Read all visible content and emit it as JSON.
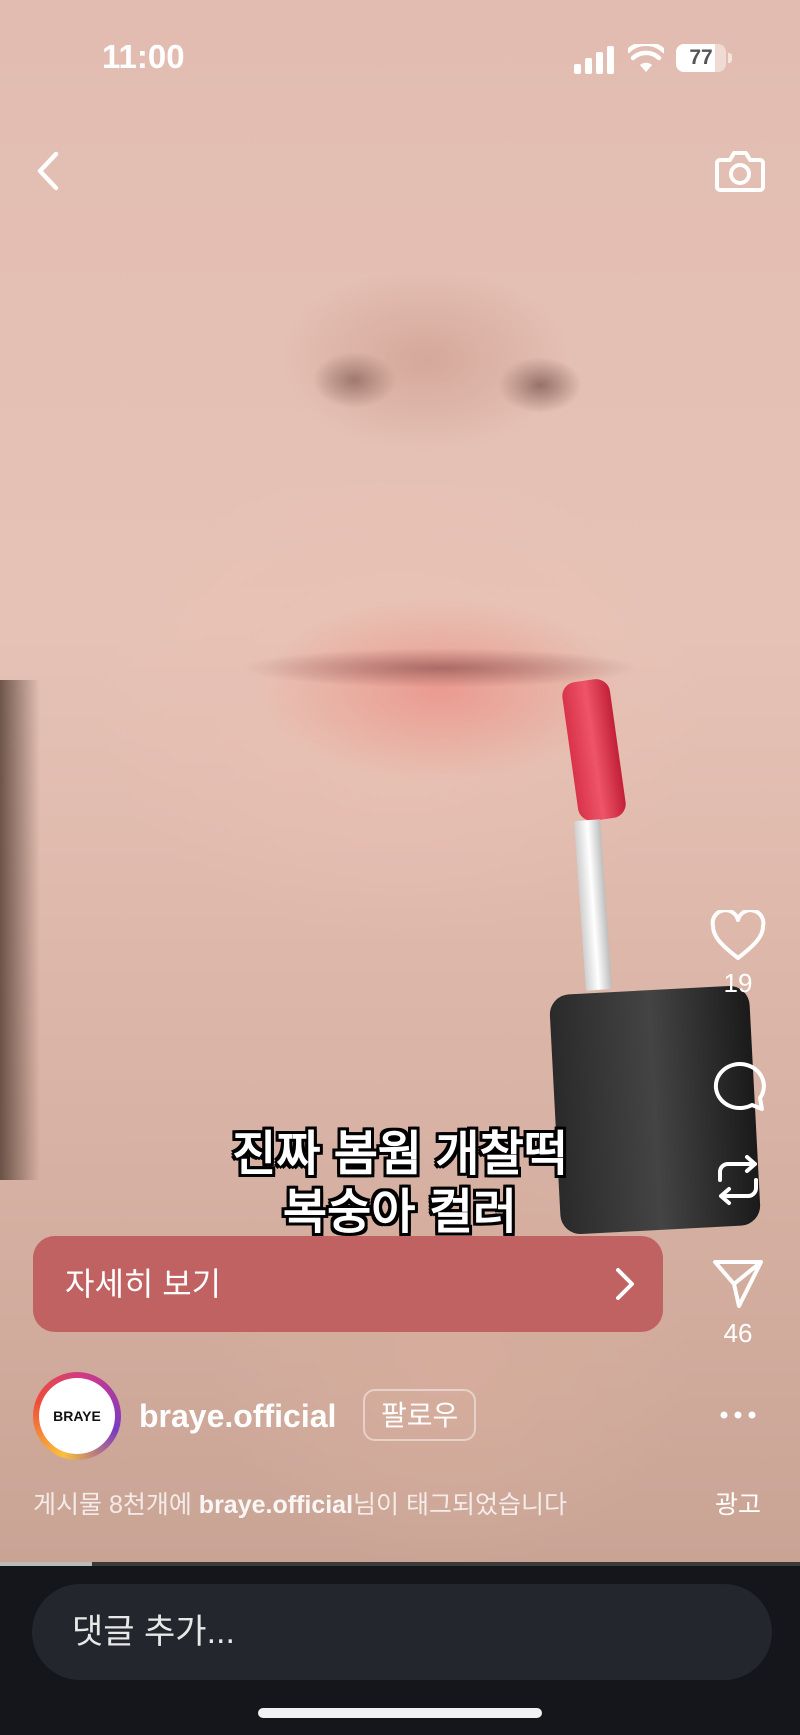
{
  "status_bar": {
    "time": "11:00",
    "battery": "77",
    "battery_level": 0.77
  },
  "nav": {
    "back_icon": "chevron-left-icon",
    "camera_icon": "camera-icon"
  },
  "overlay_caption": {
    "line1": "진짜 봄웜 개찰떡",
    "line2": "복숭아 컬러"
  },
  "cta": {
    "label": "자세히 보기",
    "color": "#c06162"
  },
  "actions": {
    "likes": "19",
    "shares": "46"
  },
  "account": {
    "avatar_logo": "BRAYE",
    "username": "braye.official",
    "follow_label": "팔로우"
  },
  "tagline": {
    "prefix": "게시물 8천개에 ",
    "account": "braye.official",
    "suffix": "님이 태그되었습니다"
  },
  "ad_label": "광고",
  "video_progress": 0.115,
  "comment": {
    "placeholder": "댓글 추가..."
  }
}
